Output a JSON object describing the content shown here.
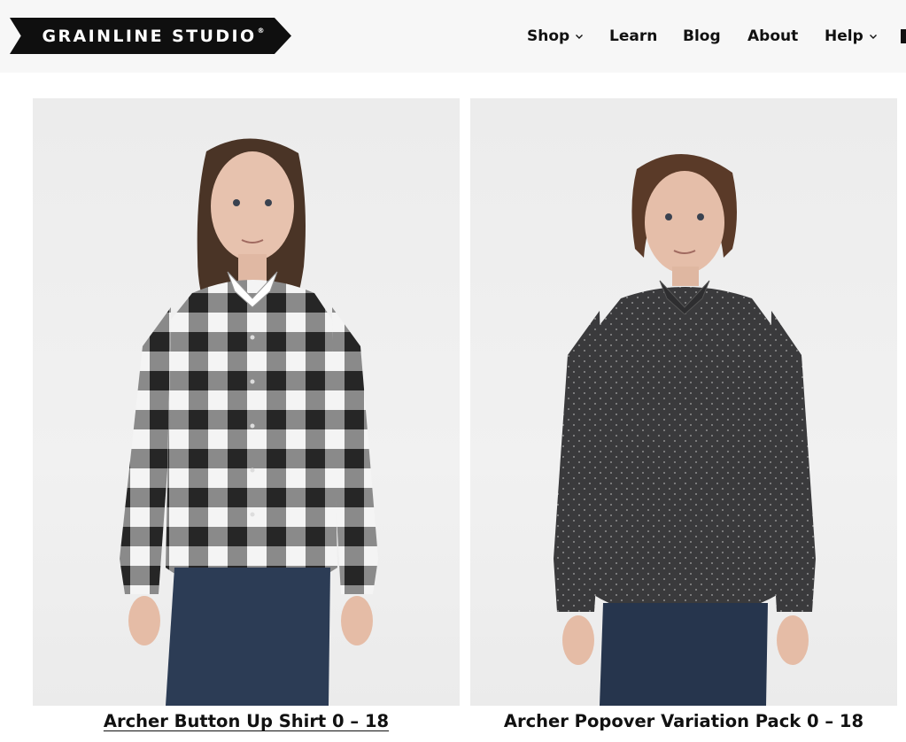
{
  "header": {
    "logo_text": "GRAINLINE STUDIO",
    "logo_mark": "®"
  },
  "nav": {
    "items": [
      {
        "label": "Shop",
        "has_dropdown": true,
        "icon": "chevron-down-icon"
      },
      {
        "label": "Learn",
        "has_dropdown": false
      },
      {
        "label": "Blog",
        "has_dropdown": false
      },
      {
        "label": "About",
        "has_dropdown": false
      },
      {
        "label": "Help",
        "has_dropdown": true,
        "icon": "chevron-down-icon"
      }
    ]
  },
  "products": [
    {
      "title": "Archer Button Up Shirt 0 – 18",
      "image": "model-in-black-white-buffalo-check-shirt",
      "underlined": true
    },
    {
      "title": "Archer Popover Variation Pack 0 – 18",
      "image": "model-in-dark-grey-dotted-popover-shirt",
      "underlined": false
    }
  ],
  "colors": {
    "header_bg": "#f7f7f7",
    "logo_bg": "#0f0f0f",
    "text": "#111111"
  }
}
